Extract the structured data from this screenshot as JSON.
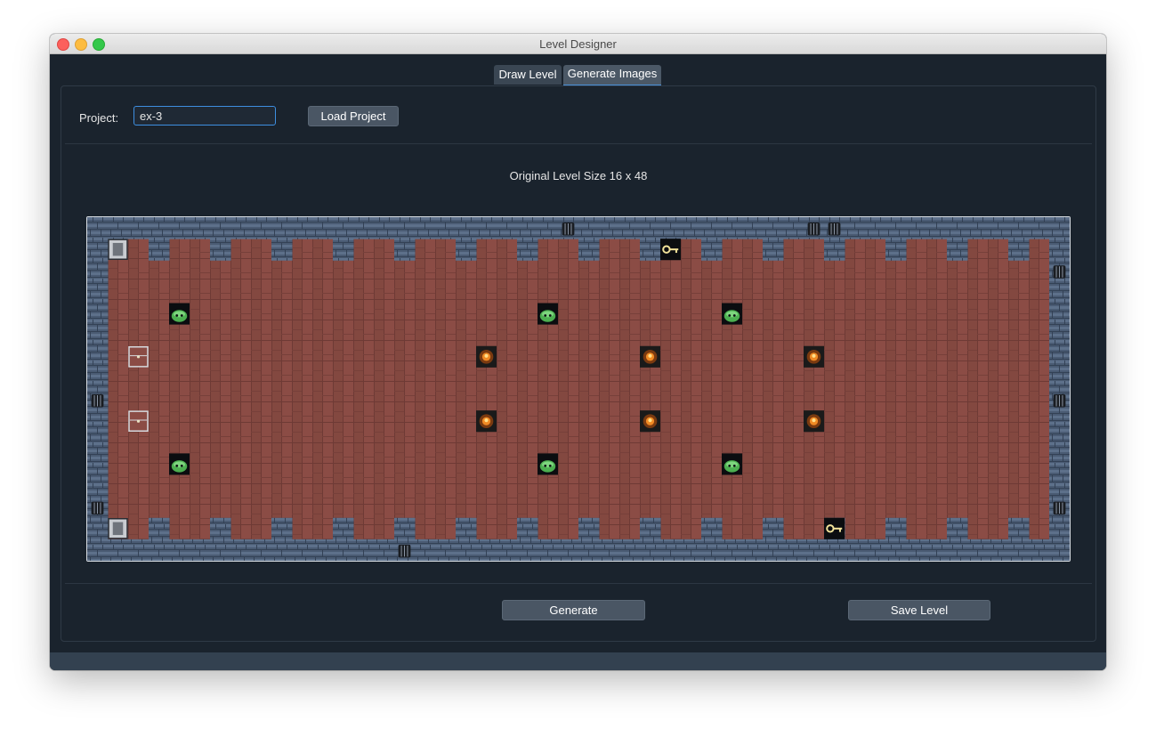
{
  "window": {
    "title": "Level Designer"
  },
  "tabs": {
    "draw_level": "Draw Level",
    "generate_images": "Generate Images"
  },
  "project": {
    "label": "Project:",
    "value": "ex-3"
  },
  "buttons": {
    "load_project": "Load Project",
    "generate": "Generate",
    "save_level": "Save Level"
  },
  "level": {
    "size_label": "Original Level Size 16 x 48",
    "rows": 16,
    "cols": 48,
    "floor_color": "#8b4c45",
    "wall_color": "#4a5b73",
    "entities": [
      {
        "type": "crate",
        "row": 1,
        "col": 1
      },
      {
        "type": "key",
        "row": 1,
        "col": 28
      },
      {
        "type": "slime",
        "row": 4,
        "col": 4
      },
      {
        "type": "slime",
        "row": 4,
        "col": 22
      },
      {
        "type": "slime",
        "row": 4,
        "col": 31
      },
      {
        "type": "chest",
        "row": 6,
        "col": 2
      },
      {
        "type": "torch",
        "row": 6,
        "col": 19
      },
      {
        "type": "torch",
        "row": 6,
        "col": 27
      },
      {
        "type": "torch",
        "row": 6,
        "col": 35
      },
      {
        "type": "chest",
        "row": 9,
        "col": 2
      },
      {
        "type": "torch",
        "row": 9,
        "col": 19
      },
      {
        "type": "torch",
        "row": 9,
        "col": 27
      },
      {
        "type": "torch",
        "row": 9,
        "col": 35
      },
      {
        "type": "slime",
        "row": 11,
        "col": 4
      },
      {
        "type": "slime",
        "row": 11,
        "col": 22
      },
      {
        "type": "slime",
        "row": 11,
        "col": 31
      },
      {
        "type": "crate",
        "row": 14,
        "col": 1
      },
      {
        "type": "key",
        "row": 14,
        "col": 36
      }
    ],
    "doors": [
      {
        "row": 0,
        "col": 23
      },
      {
        "row": 0,
        "col": 35
      },
      {
        "row": 0,
        "col": 36
      },
      {
        "row": 15,
        "col": 15
      },
      {
        "row": 2,
        "col": 47
      },
      {
        "row": 8,
        "col": 0
      },
      {
        "row": 8,
        "col": 47
      },
      {
        "row": 13,
        "col": 0
      },
      {
        "row": 13,
        "col": 47
      }
    ]
  }
}
